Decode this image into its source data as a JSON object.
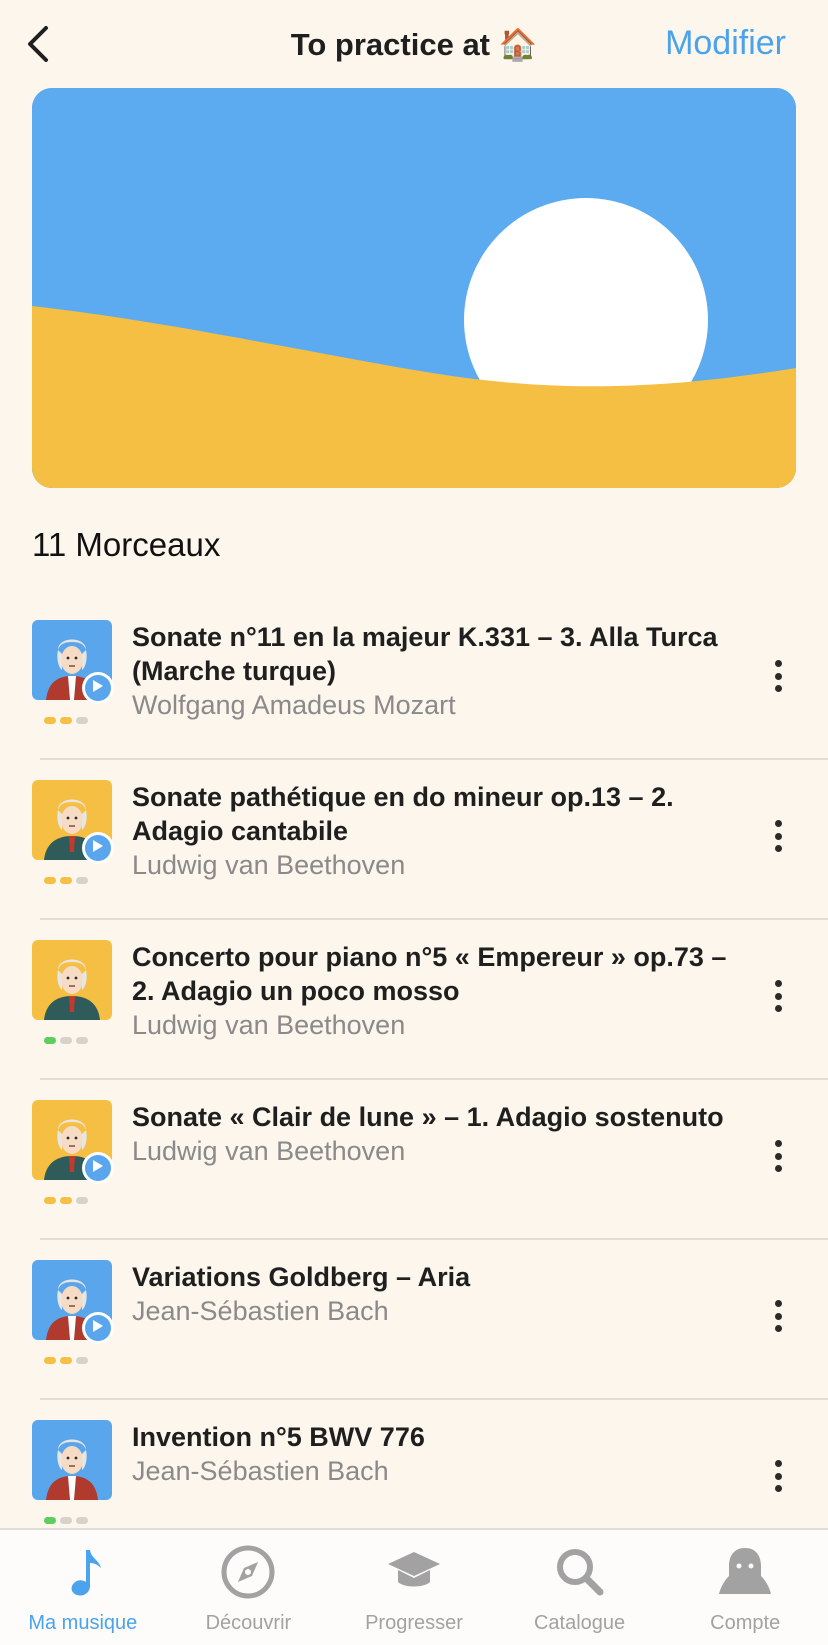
{
  "header": {
    "title": "To practice at 🏠",
    "action_label": "Modifier"
  },
  "section": {
    "count_label": "11 Morceaux"
  },
  "colors": {
    "background": "#fcf6ec",
    "accent": "#4aa3ec",
    "banner_sky": "#5cabf0",
    "banner_sand": "#f4bf42"
  },
  "pieces": [
    {
      "title": "Sonate n°11 en la majeur K.331 – 3. Alla Turca (Marche turque)",
      "composer": "Wolfgang Amadeus Mozart",
      "thumb": "blue",
      "has_play": true,
      "dots": [
        "y",
        "y",
        "n"
      ]
    },
    {
      "title": "Sonate pathétique en do mineur op.13 – 2. Adagio cantabile",
      "composer": "Ludwig van Beethoven",
      "thumb": "yellow",
      "has_play": true,
      "dots": [
        "y",
        "y",
        "n"
      ]
    },
    {
      "title": "Concerto pour piano n°5 « Empereur » op.73 – 2. Adagio un poco mosso",
      "composer": "Ludwig van Beethoven",
      "thumb": "yellow",
      "has_play": false,
      "dots": [
        "g",
        "n",
        "n"
      ]
    },
    {
      "title": "Sonate « Clair de lune » – 1. Adagio sostenuto",
      "composer": "Ludwig van Beethoven",
      "thumb": "yellow",
      "has_play": true,
      "dots": [
        "y",
        "y",
        "n"
      ]
    },
    {
      "title": "Variations Goldberg – Aria",
      "composer": "Jean-Sébastien Bach",
      "thumb": "blue",
      "has_play": true,
      "dots": [
        "y",
        "y",
        "n"
      ]
    },
    {
      "title": "Invention n°5 BWV 776",
      "composer": "Jean-Sébastien Bach",
      "thumb": "blue",
      "has_play": false,
      "dots": [
        "g",
        "n",
        "n"
      ]
    }
  ],
  "tabs": [
    {
      "label": "Ma musique",
      "icon": "music-note-icon",
      "active": true
    },
    {
      "label": "Découvrir",
      "icon": "compass-icon",
      "active": false
    },
    {
      "label": "Progresser",
      "icon": "graduation-cap-icon",
      "active": false
    },
    {
      "label": "Catalogue",
      "icon": "search-icon",
      "active": false
    },
    {
      "label": "Compte",
      "icon": "user-icon",
      "active": false
    }
  ]
}
